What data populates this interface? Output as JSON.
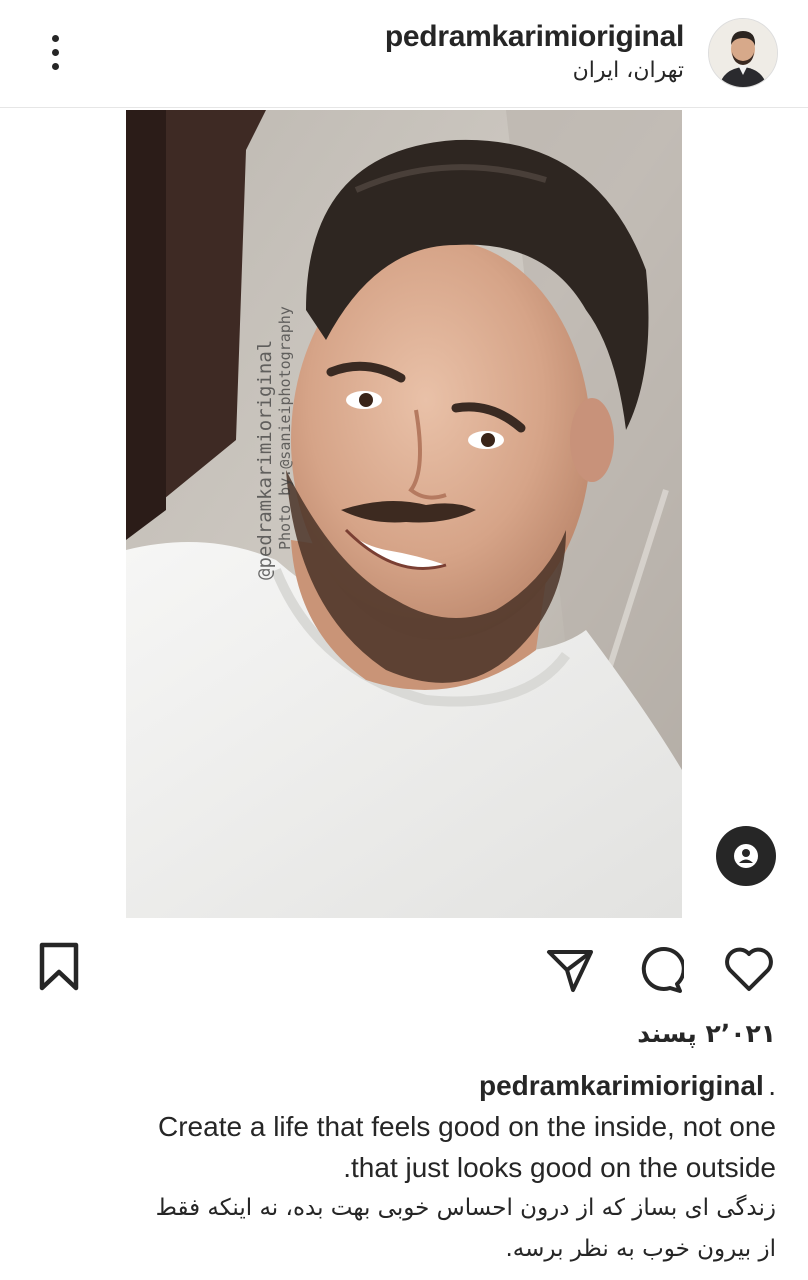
{
  "header": {
    "username": "pedramkarimioriginal",
    "location": "تهران، ایران",
    "more_icon": "more-vertical-icon"
  },
  "photo": {
    "watermark_handle": "@pedramkarimioriginal",
    "watermark_credit": "Photo by:@sanieiphotography",
    "tag_icon": "user-tag-icon"
  },
  "actions": {
    "icons": [
      "bookmark-icon",
      "share-icon",
      "comment-icon",
      "heart-icon"
    ]
  },
  "likes": {
    "count_text": "۲٬۰۲۱ پسند"
  },
  "caption": {
    "username": "pedramkarimioriginal",
    "dot": ".",
    "lines": [
      "Create a life that feels good on the inside, not one",
      ".that just looks good on the outside",
      "زندگی ای بساز که از درون احساس خوبی بهت بده، نه اینکه فقط",
      "از بیرون خوب به نظر برسه."
    ]
  },
  "colors": {
    "text": "#262626",
    "divider": "#e6e6e6",
    "background": "#ffffff"
  }
}
